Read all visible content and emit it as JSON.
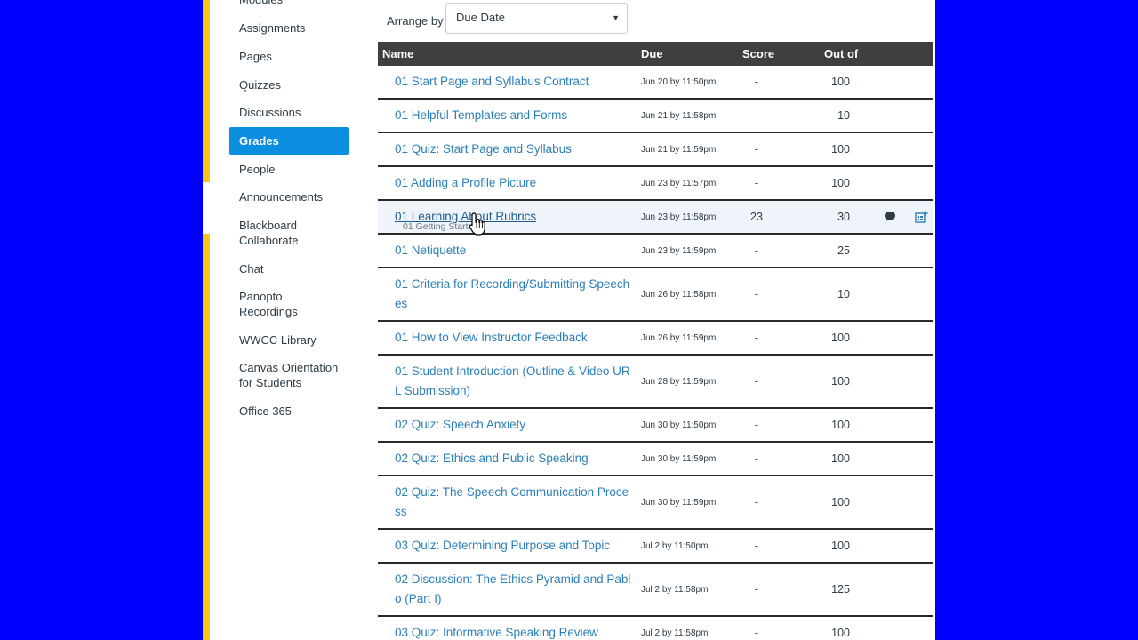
{
  "sidebar": {
    "items": [
      {
        "label": "Modules",
        "active": false
      },
      {
        "label": "Assignments",
        "active": false
      },
      {
        "label": "Pages",
        "active": false
      },
      {
        "label": "Quizzes",
        "active": false
      },
      {
        "label": "Discussions",
        "active": false
      },
      {
        "label": "Grades",
        "active": true
      },
      {
        "label": "People",
        "active": false
      },
      {
        "label": "Announcements",
        "active": false
      },
      {
        "label": "Blackboard Collaborate",
        "active": false
      },
      {
        "label": "Chat",
        "active": false
      },
      {
        "label": "Panopto Recordings",
        "active": false
      },
      {
        "label": "WWCC Library",
        "active": false
      },
      {
        "label": "Canvas Orientation for Students",
        "active": false
      },
      {
        "label": "Office 365",
        "active": false
      }
    ]
  },
  "arrange": {
    "label": "Arrange by",
    "selected": "Due Date"
  },
  "table": {
    "headers": {
      "name": "Name",
      "due": "Due",
      "score": "Score",
      "out_of": "Out of"
    },
    "rows": [
      {
        "name": "01 Start Page and Syllabus Contract",
        "due": "Jun 20 by 11:50pm",
        "score": "-",
        "out_of": "100"
      },
      {
        "name": "01 Helpful Templates and Forms",
        "due": "Jun 21 by 11:58pm",
        "score": "-",
        "out_of": "10"
      },
      {
        "name": "01 Quiz: Start Page and Syllabus",
        "due": "Jun 21 by 11:59pm",
        "score": "-",
        "out_of": "100"
      },
      {
        "name": "01 Adding a Profile Picture",
        "due": "Jun 23 by 11:57pm",
        "score": "-",
        "out_of": "100"
      },
      {
        "name": "01 Learning About Rubrics",
        "sub": "01 Getting Started",
        "due": "Jun 23 by 11:58pm",
        "score": "23",
        "out_of": "30",
        "highlight": true,
        "icons": [
          "comment-icon",
          "rubric-icon"
        ]
      },
      {
        "name": "01 Netiquette",
        "due": "Jun 23 by 11:59pm",
        "score": "-",
        "out_of": "25"
      },
      {
        "name": "01 Criteria for Recording/Submitting Speeches",
        "due": "Jun 26 by 11:58pm",
        "score": "-",
        "out_of": "10"
      },
      {
        "name": "01 How to View Instructor Feedback",
        "due": "Jun 26 by 11:59pm",
        "score": "-",
        "out_of": "100"
      },
      {
        "name": "01 Student Introduction (Outline & Video URL Submission)",
        "due": "Jun 28 by 11:59pm",
        "score": "-",
        "out_of": "100"
      },
      {
        "name": "02 Quiz: Speech Anxiety",
        "due": "Jun 30 by 11:50pm",
        "score": "-",
        "out_of": "100"
      },
      {
        "name": "02 Quiz: Ethics and Public Speaking",
        "due": "Jun 30 by 11:59pm",
        "score": "-",
        "out_of": "100"
      },
      {
        "name": "02 Quiz: The Speech Communication Process",
        "due": "Jun 30 by 11:59pm",
        "score": "-",
        "out_of": "100"
      },
      {
        "name": "03 Quiz: Determining Purpose and Topic",
        "due": "Jul 2 by 11:50pm",
        "score": "-",
        "out_of": "100"
      },
      {
        "name": "02 Discussion: The Ethics Pyramid and Pablo (Part I)",
        "due": "Jul 2 by 11:58pm",
        "score": "-",
        "out_of": "125"
      },
      {
        "name": "03 Quiz: Informative Speaking Review",
        "due": "Jul 2 by 11:58pm",
        "score": "-",
        "out_of": "100"
      }
    ]
  },
  "colors": {
    "background": "#0000ff",
    "accent_stripe": "#f5c518",
    "active_nav": "#0b8ee0",
    "link": "#2c7fb8",
    "header_bar": "#3f3f3f"
  }
}
